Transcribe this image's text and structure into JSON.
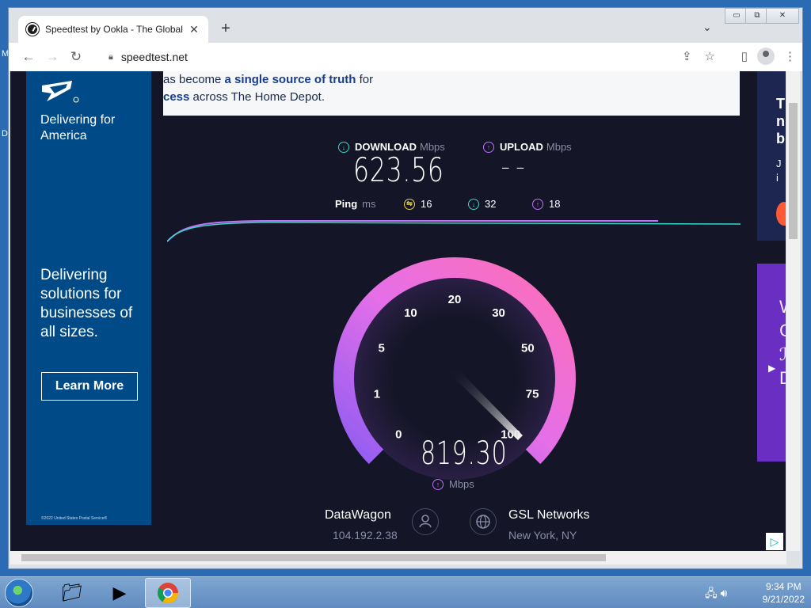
{
  "desktop": {
    "letters": [
      "M",
      "D"
    ]
  },
  "browser": {
    "tab_title": "Speedtest by Ookla - The Global",
    "tab_close": "✕",
    "new_tab": "+",
    "tab_menu": "⌄",
    "url": "speedtest.net",
    "window_controls": [
      "▭",
      "⧉",
      "✕"
    ]
  },
  "ads": {
    "usps_tagline": "Delivering for America",
    "usps_headline": "Delivering solutions for businesses of all sizes.",
    "usps_cta": "Learn More",
    "usps_copyright": "©2022 United States Postal Service®",
    "banner_line1_pre": "as become ",
    "banner_line1_hl": "a single source of truth",
    "banner_line1_post": " for",
    "banner_line2_hl": "cess",
    "banner_line2_post": " across The Home Depot.",
    "right1_chars": "To n b Jo in",
    "right2_chars": "W C ℐ D E C"
  },
  "speedtest": {
    "download_label": "DOWNLOAD",
    "download_unit": "Mbps",
    "download_value": "623.56",
    "upload_label": "UPLOAD",
    "upload_unit": "Mbps",
    "upload_value": "– –",
    "ping_label": "Ping",
    "ping_unit": "ms",
    "ping_idle": "16",
    "ping_down": "32",
    "ping_up": "18",
    "gauge_ticks": [
      "0",
      "1",
      "5",
      "10",
      "20",
      "30",
      "50",
      "75",
      "100"
    ],
    "gauge_value": "819.30",
    "gauge_unit": "Mbps",
    "isp_name": "DataWagon",
    "isp_ip": "104.192.2.38",
    "server_name": "GSL Networks",
    "server_location": "New York, NY"
  },
  "taskbar": {
    "time": "9:34 PM",
    "date": "9/21/2022"
  },
  "colors": {
    "page_bg": "#141526",
    "download_accent": "#3ad6c8",
    "upload_accent": "#bf71ff",
    "gauge_start": "#8f5cf2",
    "gauge_end": "#ff6fb5",
    "usps_blue": "#004b87"
  }
}
